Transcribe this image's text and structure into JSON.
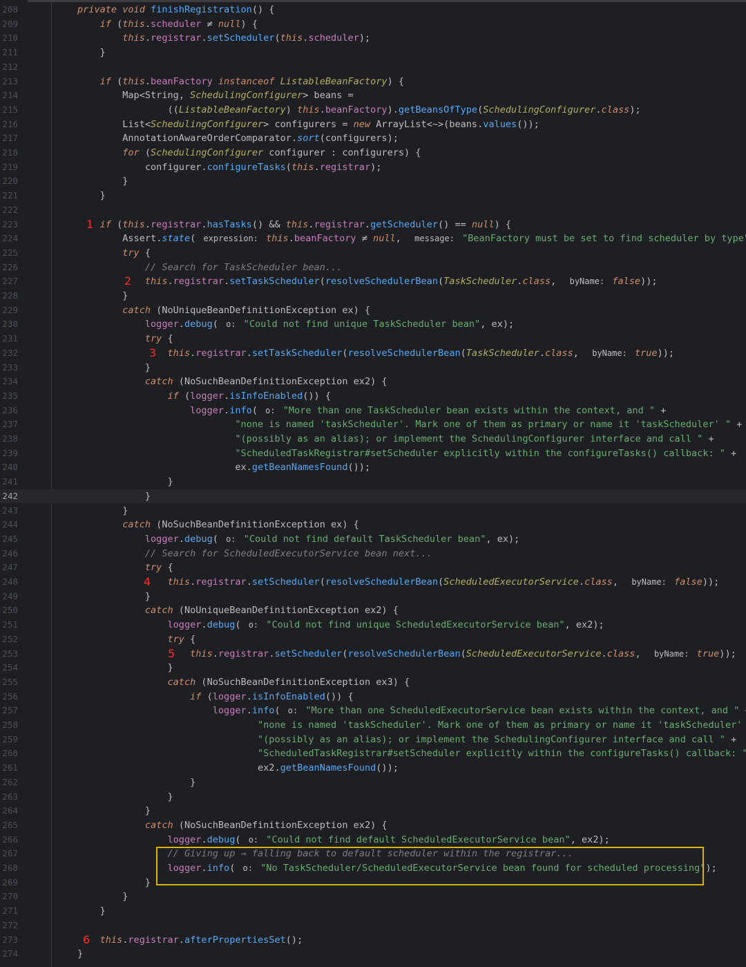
{
  "editor": {
    "current_line": 242,
    "lines": [
      {
        "n": 208,
        "html": "<span class='kw'>private void</span> <span class='mth'>finishRegistration</span>() {"
      },
      {
        "n": 209,
        "html": "    <span class='kw'>if</span> (<span class='kw'>this</span>.<span class='fld'>scheduler</span> ≠ <span class='kw'>null</span>) {"
      },
      {
        "n": 210,
        "html": "        <span class='kw'>this</span>.<span class='fld'>registrar</span>.<span class='mth'>setScheduler</span>(<span class='kw'>this</span>.<span class='fld'>scheduler</span>);"
      },
      {
        "n": 211,
        "html": "    }"
      },
      {
        "n": 212,
        "html": ""
      },
      {
        "n": 213,
        "html": "    <span class='kw'>if</span> (<span class='kw'>this</span>.<span class='fld'>beanFactory</span> <span class='kw'>instanceof</span> <span class='typ'>ListableBeanFactory</span>) {"
      },
      {
        "n": 214,
        "html": "        <span class='cls'>Map</span>&lt;<span class='cls'>String</span>, <span class='typ'>SchedulingConfigurer</span>&gt; beans ="
      },
      {
        "n": 215,
        "html": "                ((<span class='typ'>ListableBeanFactory</span>) <span class='kw'>this</span>.<span class='fld'>beanFactory</span>).<span class='mth'>getBeansOfType</span>(<span class='typ'>SchedulingConfigurer</span>.<span class='kw'>class</span>);"
      },
      {
        "n": 216,
        "html": "        <span class='cls'>List</span>&lt;<span class='typ'>SchedulingConfigurer</span>&gt; configurers = <span class='kw'>new</span> <span class='cls'>ArrayList</span>&lt;~&gt;(beans.<span class='mth'>values</span>());"
      },
      {
        "n": 217,
        "html": "        <span class='cls'>AnnotationAwareOrderComparator</span>.<span class='stat'>sort</span>(configurers);"
      },
      {
        "n": 218,
        "html": "        <span class='kw'>for</span> (<span class='typ'>SchedulingConfigurer</span> configurer : configurers) {"
      },
      {
        "n": 219,
        "html": "            configurer.<span class='mth'>configureTasks</span>(<span class='kw'>this</span>.<span class='fld'>registrar</span>);"
      },
      {
        "n": 220,
        "html": "        }"
      },
      {
        "n": 221,
        "html": "    }"
      },
      {
        "n": 222,
        "html": ""
      },
      {
        "n": 223,
        "mark": "1",
        "markx": 125,
        "html": "    <span class='kw'>if</span> (<span class='kw'>this</span>.<span class='fld'>registrar</span>.<span class='mth'>hasTasks</span>() &amp;&amp; <span class='kw'>this</span>.<span class='fld'>registrar</span>.<span class='mth'>getScheduler</span>() == <span class='kw'>null</span>) {"
      },
      {
        "n": 224,
        "html": "        <span class='cls'>Assert</span>.<span class='stat'>state</span>( <span class='hint'>expression:</span> <span class='kw'>this</span>.<span class='fld'>beanFactory</span> ≠ <span class='kw'>null</span>,  <span class='hint'>message:</span> <span class='str'>\"BeanFactory must be set to find scheduler by type\"</span>);"
      },
      {
        "n": 225,
        "html": "        <span class='kw'>try</span> {"
      },
      {
        "n": 226,
        "html": "            <span class='cmt'>// Search for TaskScheduler bean...</span>"
      },
      {
        "n": 227,
        "mark": "2",
        "markx": 180,
        "html": "            <span class='kw'>this</span>.<span class='fld'>registrar</span>.<span class='mth'>setTaskScheduler</span>(<span class='mth'>resolveSchedulerBean</span>(<span class='typ'>TaskScheduler</span>.<span class='kw'>class</span>,  <span class='hint'>byName:</span> <span class='kw'>false</span>));"
      },
      {
        "n": 228,
        "html": "        }"
      },
      {
        "n": 229,
        "html": "        <span class='kw'>catch</span> (<span class='cls'>NoUniqueBeanDefinitionException</span> ex) {"
      },
      {
        "n": 230,
        "html": "            <span class='fld'>logger</span>.<span class='mth'>debug</span>( <span class='hint'>o:</span> <span class='str'>\"Could not find unique TaskScheduler bean\"</span>, ex);"
      },
      {
        "n": 231,
        "html": "            <span class='kw'>try</span> {"
      },
      {
        "n": 232,
        "mark": "3",
        "markx": 216,
        "html": "                <span class='kw'>this</span>.<span class='fld'>registrar</span>.<span class='mth'>setTaskScheduler</span>(<span class='mth'>resolveSchedulerBean</span>(<span class='typ'>TaskScheduler</span>.<span class='kw'>class</span>,  <span class='hint'>byName:</span> <span class='kw'>true</span>));"
      },
      {
        "n": 233,
        "html": "            }"
      },
      {
        "n": 234,
        "html": "            <span class='kw'>catch</span> (<span class='cls'>NoSuchBeanDefinitionException</span> ex2) {"
      },
      {
        "n": 235,
        "html": "                <span class='kw'>if</span> (<span class='fld'>logger</span>.<span class='mth'>isInfoEnabled</span>()) {"
      },
      {
        "n": 236,
        "html": "                    <span class='fld'>logger</span>.<span class='mth'>info</span>( <span class='hint'>o:</span> <span class='str'>\"More than one TaskScheduler bean exists within the context, and \"</span> +"
      },
      {
        "n": 237,
        "html": "                            <span class='str'>\"none is named 'taskScheduler'. Mark one of them as primary or name it 'taskScheduler' \"</span> +"
      },
      {
        "n": 238,
        "html": "                            <span class='str'>\"(possibly as an alias); or implement the SchedulingConfigurer interface and call \"</span> +"
      },
      {
        "n": 239,
        "html": "                            <span class='str'>\"ScheduledTaskRegistrar#setScheduler explicitly within the configureTasks() callback: \"</span> +"
      },
      {
        "n": 240,
        "html": "                            ex.<span class='mth'>getBeanNamesFound</span>());"
      },
      {
        "n": 241,
        "html": "                }"
      },
      {
        "n": 242,
        "html": "            }"
      },
      {
        "n": 243,
        "html": "        }"
      },
      {
        "n": 244,
        "html": "        <span class='kw'>catch</span> (<span class='cls'>NoSuchBeanDefinitionException</span> ex) {"
      },
      {
        "n": 245,
        "html": "            <span class='fld'>logger</span>.<span class='mth'>debug</span>( <span class='hint'>o:</span> <span class='str'>\"Could not find default TaskScheduler bean\"</span>, ex);"
      },
      {
        "n": 246,
        "html": "            <span class='cmt'>// Search for ScheduledExecutorService bean next...</span>"
      },
      {
        "n": 247,
        "html": "            <span class='kw'>try</span> {"
      },
      {
        "n": 248,
        "mark": "4",
        "markx": 208,
        "html": "                <span class='kw'>this</span>.<span class='fld'>registrar</span>.<span class='mth'>setScheduler</span>(<span class='mth'>resolveSchedulerBean</span>(<span class='typ'>ScheduledExecutorService</span>.<span class='kw'>class</span>,  <span class='hint'>byName:</span> <span class='kw'>false</span>));"
      },
      {
        "n": 249,
        "html": "            }"
      },
      {
        "n": 250,
        "html": "            <span class='kw'>catch</span> (<span class='cls'>NoUniqueBeanDefinitionException</span> ex2) {"
      },
      {
        "n": 251,
        "html": "                <span class='fld'>logger</span>.<span class='mth'>debug</span>( <span class='hint'>o:</span> <span class='str'>\"Could not find unique ScheduledExecutorService bean\"</span>, ex2);"
      },
      {
        "n": 252,
        "html": "                <span class='kw'>try</span> {"
      },
      {
        "n": 253,
        "mark": "5",
        "markx": 243,
        "html": "                    <span class='kw'>this</span>.<span class='fld'>registrar</span>.<span class='mth'>setScheduler</span>(<span class='mth'>resolveSchedulerBean</span>(<span class='typ'>ScheduledExecutorService</span>.<span class='kw'>class</span>,  <span class='hint'>byName:</span> <span class='kw'>true</span>));"
      },
      {
        "n": 254,
        "html": "                }"
      },
      {
        "n": 255,
        "html": "                <span class='kw'>catch</span> (<span class='cls'>NoSuchBeanDefinitionException</span> ex3) {"
      },
      {
        "n": 256,
        "html": "                    <span class='kw'>if</span> (<span class='fld'>logger</span>.<span class='mth'>isInfoEnabled</span>()) {"
      },
      {
        "n": 257,
        "html": "                        <span class='fld'>logger</span>.<span class='mth'>info</span>( <span class='hint'>o:</span> <span class='str'>\"More than one ScheduledExecutorService bean exists within the context, and \"</span> +"
      },
      {
        "n": 258,
        "html": "                                <span class='str'>\"none is named 'taskScheduler'. Mark one of them as primary or name it 'taskScheduler' \"</span> +"
      },
      {
        "n": 259,
        "html": "                                <span class='str'>\"(possibly as an alias); or implement the SchedulingConfigurer interface and call \"</span> +"
      },
      {
        "n": 260,
        "html": "                                <span class='str'>\"ScheduledTaskRegistrar#setScheduler explicitly within the configureTasks() callback: \"</span> +"
      },
      {
        "n": 261,
        "html": "                                ex2.<span class='mth'>getBeanNamesFound</span>());"
      },
      {
        "n": 262,
        "html": "                    }"
      },
      {
        "n": 263,
        "html": "                }"
      },
      {
        "n": 264,
        "html": "            }"
      },
      {
        "n": 265,
        "html": "            <span class='kw'>catch</span> (<span class='cls'>NoSuchBeanDefinitionException</span> ex2) {"
      },
      {
        "n": 266,
        "html": "                <span class='fld'>logger</span>.<span class='mth'>debug</span>( <span class='hint'>o:</span> <span class='str'>\"Could not find default ScheduledExecutorService bean\"</span>, ex2);"
      },
      {
        "n": 267,
        "html": "                <span class='cmt'>// Giving up → falling back to default scheduler within the registrar...</span>"
      },
      {
        "n": 268,
        "html": "                <span class='fld'>logger</span>.<span class='mth'>info</span>( <span class='hint'>o:</span> <span class='str'>\"No TaskScheduler/ScheduledExecutorService bean found for scheduled processing\"</span>);"
      },
      {
        "n": 269,
        "html": "            }"
      },
      {
        "n": 270,
        "html": "        }"
      },
      {
        "n": 271,
        "html": "    }"
      },
      {
        "n": 272,
        "html": ""
      },
      {
        "n": 273,
        "mark": "6",
        "markx": 120,
        "html": "    <span class='kw'>this</span>.<span class='fld'>registrar</span>.<span class='mth'>afterPropertiesSet</span>();"
      },
      {
        "n": 274,
        "html": "}"
      }
    ]
  }
}
